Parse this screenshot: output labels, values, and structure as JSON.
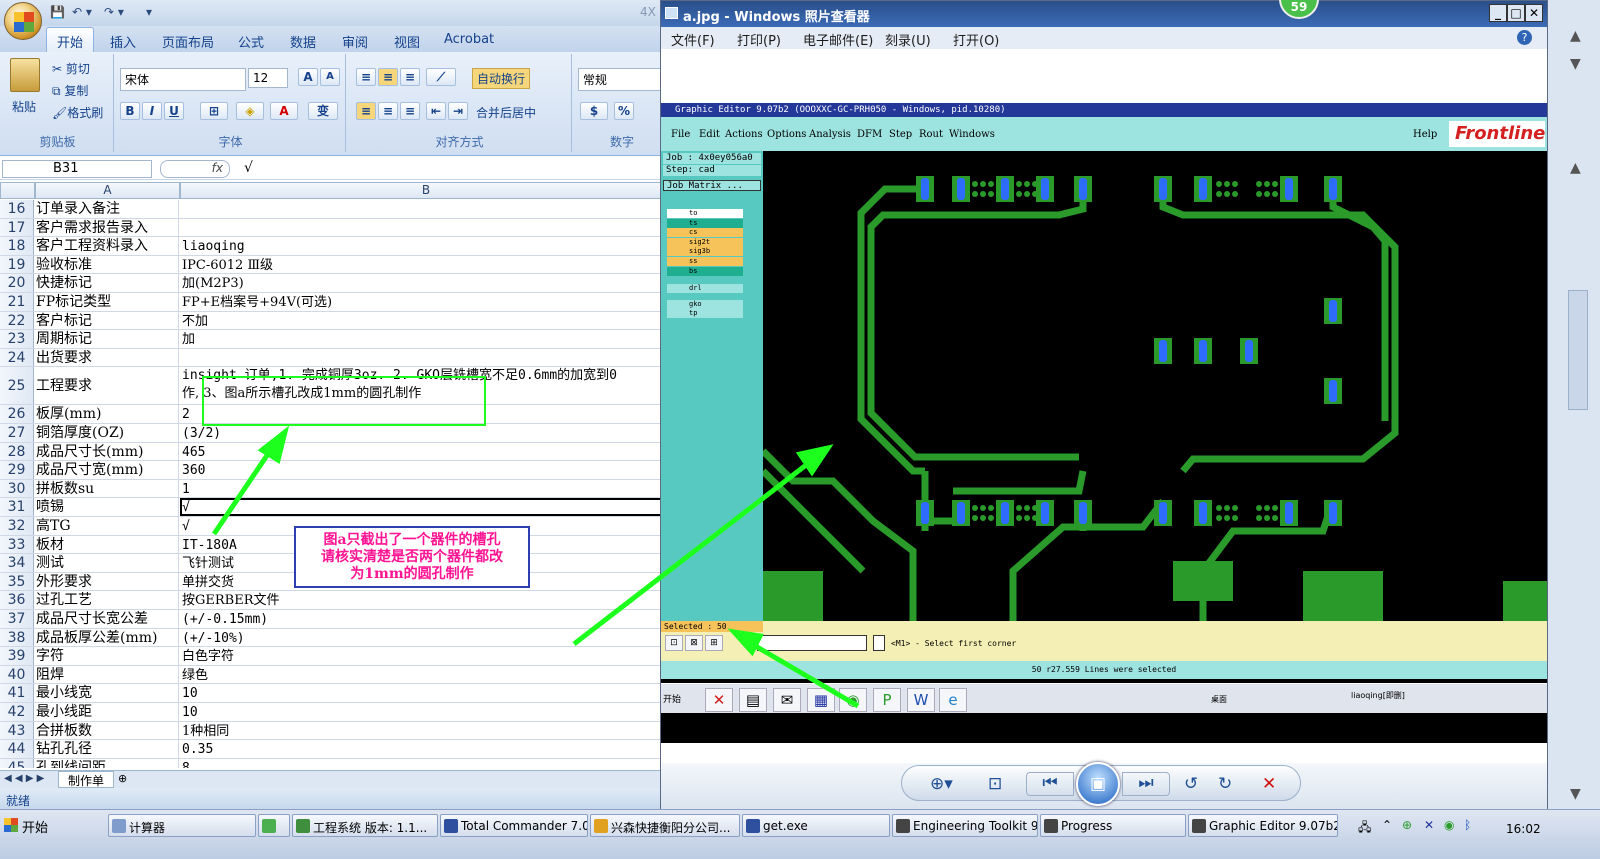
{
  "excel": {
    "qat_cut_label": "4X",
    "tabs": [
      "开始",
      "插入",
      "页面布局",
      "公式",
      "数据",
      "审阅",
      "视图",
      "Acrobat"
    ],
    "clipboard": {
      "paste": "粘贴",
      "cut": "剪切",
      "copy": "复制",
      "format_painter": "格式刷",
      "group": "剪贴板"
    },
    "font": {
      "name": "宋体",
      "size": "12",
      "group": "字体",
      "bold": "B",
      "italic": "I",
      "underline": "U",
      "grow": "A",
      "shrink": "A",
      "color_a": "A",
      "phonetic": "变"
    },
    "align": {
      "wrap": "自动换行",
      "merge": "合并后居中",
      "group": "对齐方式"
    },
    "number": {
      "format": "常规",
      "percent": "%",
      "group": "数字"
    },
    "name_box": "B31",
    "fx": "fx",
    "formula_value": "√",
    "col_a": "A",
    "col_b": "B",
    "rows": [
      {
        "n": "16",
        "a": "订单录入备注",
        "b": ""
      },
      {
        "n": "17",
        "a": "客户需求报告录入",
        "b": ""
      },
      {
        "n": "18",
        "a": "客户工程资料录入",
        "b": "liaoqing"
      },
      {
        "n": "19",
        "a": "验收标准",
        "b": "IPC-6012 Ⅲ级"
      },
      {
        "n": "20",
        "a": "快捷标记",
        "b": "加(M2P3)"
      },
      {
        "n": "21",
        "a": "FP标记类型",
        "b": "FP+E档案号+94V(可选)"
      },
      {
        "n": "22",
        "a": "客户标记",
        "b": "不加"
      },
      {
        "n": "23",
        "a": "周期标记",
        "b": "加"
      },
      {
        "n": "24",
        "a": "出货要求",
        "b": ""
      },
      {
        "n": "25",
        "a": "工程要求",
        "b": "insight 订单,1. 完成铜厚3oz. 2. GKO层铣槽宽不足0.6mm的加宽到0",
        "b2": "作, 3、图a所示槽孔改成1mm的圆孔制作"
      },
      {
        "n": "26",
        "a": "板厚(mm)",
        "b": "2"
      },
      {
        "n": "27",
        "a": "铜箔厚度(OZ)",
        "b": "(3/2)"
      },
      {
        "n": "28",
        "a": "成品尺寸长(mm)",
        "b": "465"
      },
      {
        "n": "29",
        "a": "成品尺寸宽(mm)",
        "b": "360"
      },
      {
        "n": "30",
        "a": "拼板数su",
        "b": "1"
      },
      {
        "n": "31",
        "a": "喷锡",
        "b": "√"
      },
      {
        "n": "32",
        "a": "高TG",
        "b": "√"
      },
      {
        "n": "33",
        "a": "板材",
        "b": "IT-180A"
      },
      {
        "n": "34",
        "a": "测试",
        "b": "飞针测试"
      },
      {
        "n": "35",
        "a": "外形要求",
        "b": "单拼交货"
      },
      {
        "n": "36",
        "a": "过孔工艺",
        "b": "按GERBER文件"
      },
      {
        "n": "37",
        "a": "成品尺寸长宽公差",
        "b": "(+/-0.15mm)"
      },
      {
        "n": "38",
        "a": "成品板厚公差(mm)",
        "b": "(+/-10%)"
      },
      {
        "n": "39",
        "a": "字符",
        "b": "白色字符"
      },
      {
        "n": "40",
        "a": "阻焊",
        "b": "绿色"
      },
      {
        "n": "41",
        "a": "最小线宽",
        "b": "10"
      },
      {
        "n": "42",
        "a": "最小线距",
        "b": "10"
      },
      {
        "n": "43",
        "a": "合拼板数",
        "b": "1种相同"
      },
      {
        "n": "44",
        "a": "钻孔孔径",
        "b": "0.35"
      },
      {
        "n": "45",
        "a": "孔到线间距",
        "b": "8"
      }
    ],
    "sheet_tab": "制作单",
    "status": "就绪"
  },
  "annotation": {
    "note_lines": [
      "图a只截出了一个器件的槽孔",
      "请核实清楚是否两个器件都改",
      "为1mm的圆孔制作"
    ],
    "note_color": "#ff1493",
    "arrow_color": "#1dff1d"
  },
  "viewer": {
    "title": "a.jpg - Windows 照片查看器",
    "badge": "59",
    "menu": [
      "文件(F)",
      "打印(P)",
      "电子邮件(E)",
      "刻录(U)",
      "打开(O)"
    ],
    "help": "?",
    "ge": {
      "title": "Graphic Editor 9.07b2 (OOOXXC-GC-PRH050 - Windows, pid.10280)",
      "menu": [
        "File",
        "Edit",
        "Actions",
        "Options",
        "Analysis",
        "DFM",
        "Step",
        "Rout",
        "Windows"
      ],
      "help": "Help",
      "brand": "Frontline",
      "job": "Job : 4x0ey056a0",
      "step": "Step: cad",
      "matrix": "Job Matrix ...",
      "layers": [
        {
          "name": "to",
          "color": "#ffffff"
        },
        {
          "name": "ts",
          "color": "#1fae8f"
        },
        {
          "name": "cs",
          "color": "#f6c35a"
        },
        {
          "name": "sig2t",
          "color": "#f6c35a"
        },
        {
          "name": "sig3b",
          "color": "#f6c35a"
        },
        {
          "name": "ss",
          "color": "#f6c35a"
        },
        {
          "name": "bs",
          "color": "#1fae8f"
        },
        {
          "name": "drl",
          "color": "#9de3e0"
        },
        {
          "name": "gko",
          "color": "#9de3e0"
        },
        {
          "name": "tp",
          "color": "#9de3e0"
        }
      ],
      "selected": "Selected : 50",
      "prompt": "<M1> - Select first corner",
      "status": "50 r27.559 Lines were selected",
      "task_start": "开始",
      "task_desktop": "桌面",
      "task_user": "liaoqing[即删]",
      "trace_color": "#2a9b2a",
      "pad_color": "#2e6bff"
    },
    "controls": [
      "search-zoom",
      "fit",
      "prev",
      "slideshow",
      "next",
      "rotate-left",
      "rotate-right",
      "delete"
    ]
  },
  "taskbar": {
    "start": "开始",
    "items": [
      {
        "label": "计算器",
        "color": "#7f9ccc"
      },
      {
        "label": "",
        "color": "#4caf50"
      },
      {
        "label": "工程系统 版本: 1.1...",
        "color": "#3e8e3e"
      },
      {
        "label": "Total Commander 7.0 ...",
        "color": "#2d4f9e"
      },
      {
        "label": "兴森快捷衡阳分公司...",
        "color": "#e0a020"
      },
      {
        "label": "get.exe",
        "color": "#2d4f9e"
      },
      {
        "label": "Engineering Toolkit 9.0...",
        "color": "#444"
      },
      {
        "label": "Progress",
        "color": "#444"
      },
      {
        "label": "Graphic Editor 9.07b2 (...",
        "color": "#444"
      }
    ],
    "clock": "16:02"
  }
}
